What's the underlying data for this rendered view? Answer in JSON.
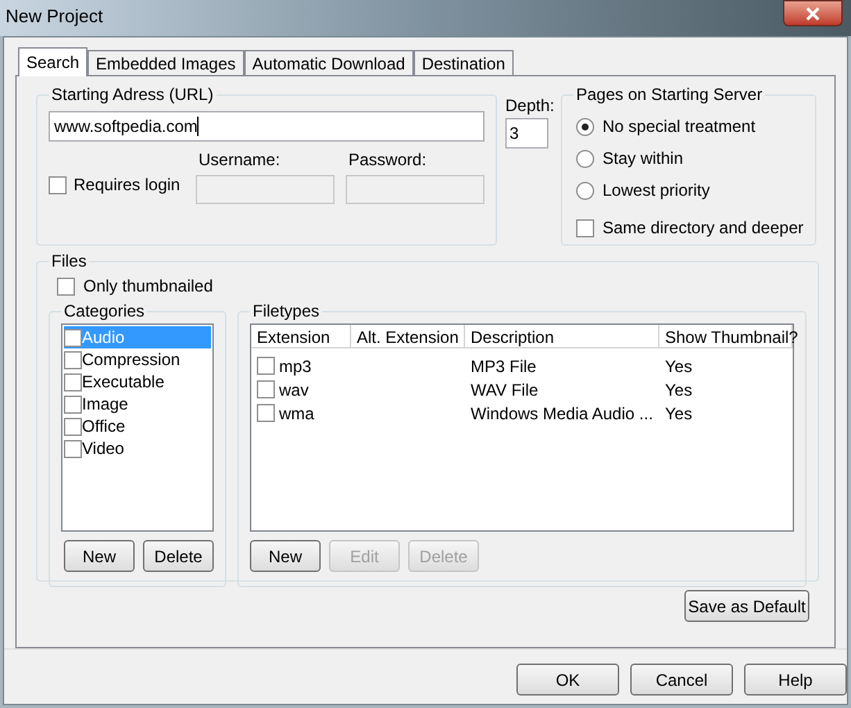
{
  "window": {
    "title": "New Project"
  },
  "tabs": [
    {
      "label": "Search",
      "selected": true
    },
    {
      "label": "Embedded Images",
      "selected": false
    },
    {
      "label": "Automatic Download",
      "selected": false
    },
    {
      "label": "Destination",
      "selected": false
    }
  ],
  "address": {
    "legend": "Starting Adress (URL)",
    "value": "www.softpedia.com"
  },
  "login": {
    "label": "Requires login",
    "checked": false
  },
  "username": {
    "label": "Username:"
  },
  "password": {
    "label": "Password:"
  },
  "depth": {
    "label": "Depth:",
    "value": "3"
  },
  "pages": {
    "legend": "Pages on Starting Server",
    "options": [
      {
        "label": "No special treatment",
        "selected": true
      },
      {
        "label": "Stay within",
        "selected": false
      },
      {
        "label": "Lowest priority",
        "selected": false
      }
    ],
    "same_directory": {
      "label": "Same directory and deeper",
      "checked": false
    }
  },
  "files": {
    "legend": "Files",
    "only_thumbnailed": {
      "label": "Only thumbnailed",
      "checked": false
    },
    "categories": {
      "legend": "Categories",
      "items": [
        {
          "label": "Audio",
          "checked": false,
          "selected": true
        },
        {
          "label": "Compression",
          "checked": false,
          "selected": false
        },
        {
          "label": "Executable",
          "checked": false,
          "selected": false
        },
        {
          "label": "Image",
          "checked": false,
          "selected": false
        },
        {
          "label": "Office",
          "checked": false,
          "selected": false
        },
        {
          "label": "Video",
          "checked": false,
          "selected": false
        }
      ],
      "buttons": [
        {
          "label": "New",
          "disabled": false
        },
        {
          "label": "Delete",
          "disabled": false
        }
      ]
    },
    "filetypes": {
      "legend": "Filetypes",
      "columns": [
        "Extension",
        "Alt. Extension",
        "Description",
        "Show Thumbnail?"
      ],
      "rows": [
        {
          "checked": false,
          "cells": [
            "mp3",
            "",
            "MP3 File",
            "Yes"
          ]
        },
        {
          "checked": false,
          "cells": [
            "wav",
            "",
            "WAV File",
            "Yes"
          ]
        },
        {
          "checked": false,
          "cells": [
            "wma",
            "",
            "Windows Media Audio ...",
            "Yes"
          ]
        }
      ],
      "buttons": [
        {
          "label": "New",
          "disabled": false
        },
        {
          "label": "Edit",
          "disabled": true
        },
        {
          "label": "Delete",
          "disabled": true
        }
      ]
    }
  },
  "save_default": {
    "label": "Save as Default"
  },
  "footer_buttons": [
    "OK",
    "Cancel",
    "Help"
  ]
}
